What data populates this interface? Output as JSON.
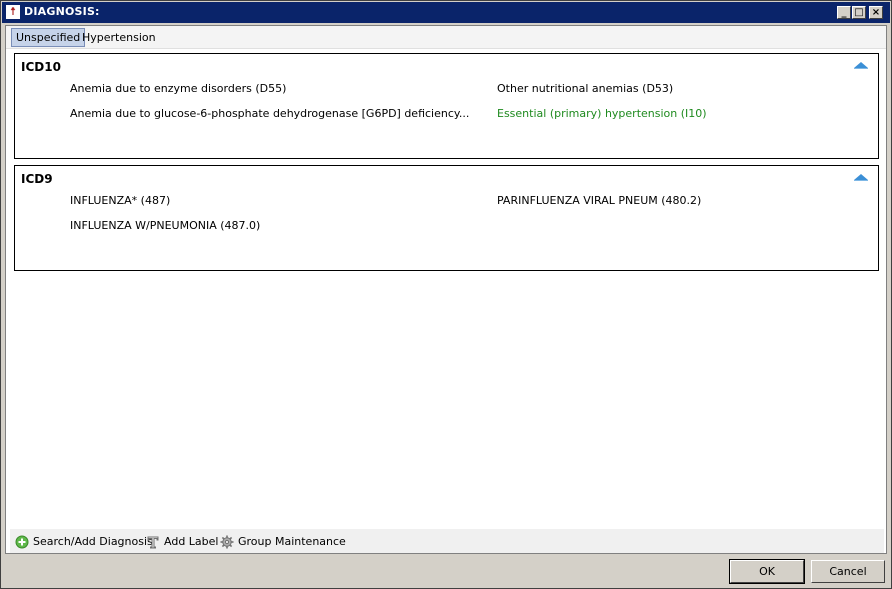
{
  "window": {
    "title": "DIAGNOSIS:"
  },
  "title_buttons": {
    "minimize": "_",
    "maximize": "□",
    "close": "×"
  },
  "tabs": [
    {
      "label": "Unspecified",
      "active": true
    },
    {
      "label": "Hypertension",
      "active": false
    }
  ],
  "groups": [
    {
      "title": "ICD10",
      "items": [
        {
          "text": "Anemia due to enzyme disorders (D55)"
        },
        {
          "text": "Other nutritional anemias (D53)"
        },
        {
          "text": "Anemia  due  to  glucose-6-phosphate  dehydrogenase  [G6PD]  deficiency..."
        },
        {
          "text": "Essential  (primary)  hypertension  (I10)",
          "color": "#1f8a1f"
        }
      ]
    },
    {
      "title": "ICD9",
      "items": [
        {
          "text": "INFLUENZA* (487)"
        },
        {
          "text": "PARINFLUENZA VIRAL PNEUM (480.2)"
        },
        {
          "text": "INFLUENZA W/PNEUMONIA (487.0)"
        }
      ]
    }
  ],
  "toolbar": {
    "search_add": "Search/Add Diagnosis",
    "add_label": "Add Label",
    "group_maintenance": "Group Maintenance"
  },
  "buttons": {
    "ok": "OK",
    "cancel": "Cancel"
  },
  "colors": {
    "titlebar": "#0a246a",
    "active_tab": "#c6d3e9",
    "highlight_text": "#1f8a1f",
    "collapse_arrow": "#3b8fd6"
  },
  "icons": [
    "app-icon",
    "minimize-icon",
    "maximize-icon",
    "close-icon",
    "collapse-arrow-icon",
    "plus-circle-icon",
    "text-label-icon",
    "gear-icon"
  ]
}
